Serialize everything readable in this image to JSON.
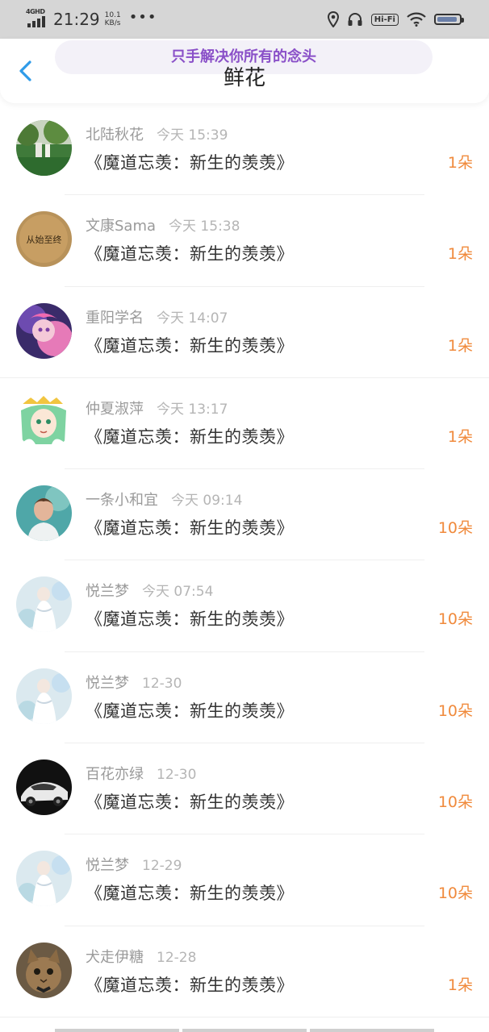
{
  "status_bar": {
    "network": "4G",
    "network_sup": "HD",
    "time": "21:29",
    "speed_value": "10.1",
    "speed_unit": "KB/s",
    "more": "•••",
    "hifi": "Hi-Fi"
  },
  "header": {
    "banner": "只手解决你所有的念头",
    "title": "鲜花"
  },
  "colors": {
    "accent_count": "#f08a3c",
    "back_arrow": "#2f9be8",
    "banner_text": "#8a50c8"
  },
  "items": [
    {
      "name": "北陆秋花",
      "time": "今天 15:39",
      "book": "《魔道忘羡：新生的羡羡》",
      "count": "1朵",
      "avatar": "park-scene"
    },
    {
      "name": "文康Sama",
      "time": "今天 15:38",
      "book": "《魔道忘羡：新生的羡羡》",
      "count": "1朵",
      "avatar": "text-seal"
    },
    {
      "name": "重阳学名",
      "time": "今天 14:07",
      "book": "《魔道忘羡：新生的羡羡》",
      "count": "1朵",
      "avatar": "pink-hair-girl"
    },
    {
      "name": "仲夏淑萍",
      "time": "今天 13:17",
      "book": "《魔道忘羡：新生的羡羡》",
      "count": "1朵",
      "avatar": "green-hair-anime"
    },
    {
      "name": "一条小和宜",
      "time": "今天 09:14",
      "book": "《魔道忘羡：新生的羡羡》",
      "count": "10朵",
      "avatar": "boy-portrait"
    },
    {
      "name": "悦兰梦",
      "time": "今天 07:54",
      "book": "《魔道忘羡：新生的羡羡》",
      "count": "10朵",
      "avatar": "white-dress"
    },
    {
      "name": "悦兰梦",
      "time": "12-30",
      "book": "《魔道忘羡：新生的羡羡》",
      "count": "10朵",
      "avatar": "white-dress"
    },
    {
      "name": "百花亦绿",
      "time": "12-30",
      "book": "《魔道忘羡：新生的羡羡》",
      "count": "10朵",
      "avatar": "sports-car"
    },
    {
      "name": "悦兰梦",
      "time": "12-29",
      "book": "《魔道忘羡：新生的羡羡》",
      "count": "10朵",
      "avatar": "white-dress"
    },
    {
      "name": "犬走伊糖",
      "time": "12-28",
      "book": "《魔道忘羡：新生的羡羡》",
      "count": "1朵",
      "avatar": "kitten"
    }
  ],
  "avatar_seal_text": "从始至终"
}
